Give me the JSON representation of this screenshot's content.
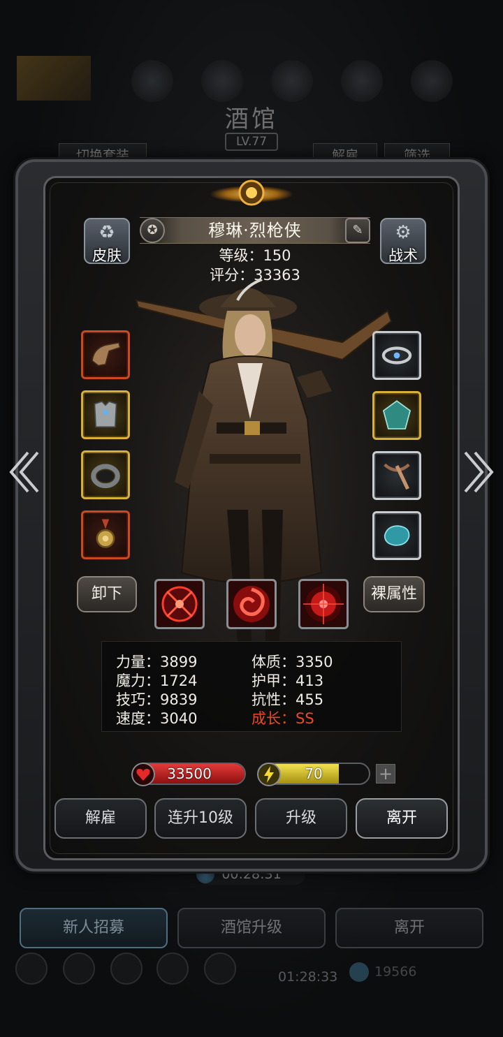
{
  "background": {
    "title": "酒馆",
    "level": "LV.77",
    "tabs": {
      "switch_outfit": "切换套装",
      "dismiss": "解雇",
      "filter": "筛选"
    },
    "timer": "00:28:31",
    "bottom_buttons": {
      "recruit": "新人招募",
      "upgrade_tavern": "酒馆升级",
      "leave": "离开"
    },
    "bottom_timer": "01:28:33",
    "coins": "19566"
  },
  "hero": {
    "name": "穆琳·烈枪侠",
    "level_line": "等级：150",
    "score_line": "评分：33363"
  },
  "side_buttons": {
    "skin": "皮肤",
    "tactics": "战术"
  },
  "slots_left": [
    {
      "name": "pistol-icon",
      "rarity": "red"
    },
    {
      "name": "armor-icon",
      "rarity": "gold"
    },
    {
      "name": "ring-icon",
      "rarity": "gold"
    },
    {
      "name": "medal-icon",
      "rarity": "red"
    }
  ],
  "slots_right": [
    {
      "name": "bracelet-icon",
      "rarity": "silver"
    },
    {
      "name": "gem-icon",
      "rarity": "gold"
    },
    {
      "name": "crossbow-icon",
      "rarity": "silver"
    },
    {
      "name": "stone-icon",
      "rarity": "silver"
    }
  ],
  "buttons": {
    "unequip": "卸下",
    "base_attributes": "裸属性"
  },
  "stats": {
    "strength": "力量：3899",
    "magic": "魔力：1724",
    "skill": "技巧：9839",
    "speed": "速度：3040",
    "constitution": "体质：3350",
    "armor": "护甲：413",
    "resistance": "抗性：455",
    "growth": "成长：SS"
  },
  "bars": {
    "hp": {
      "value": "33500",
      "fill": 1.0
    },
    "energy": {
      "value": "70",
      "fill": 0.73
    }
  },
  "actions": {
    "dismiss": "解雇",
    "level_up_10": "连升10级",
    "level_up": "升级",
    "leave": "离开"
  },
  "colors": {
    "growth": "#e94a25",
    "hp": "#c81e1e",
    "energy": "#d9c62a"
  }
}
